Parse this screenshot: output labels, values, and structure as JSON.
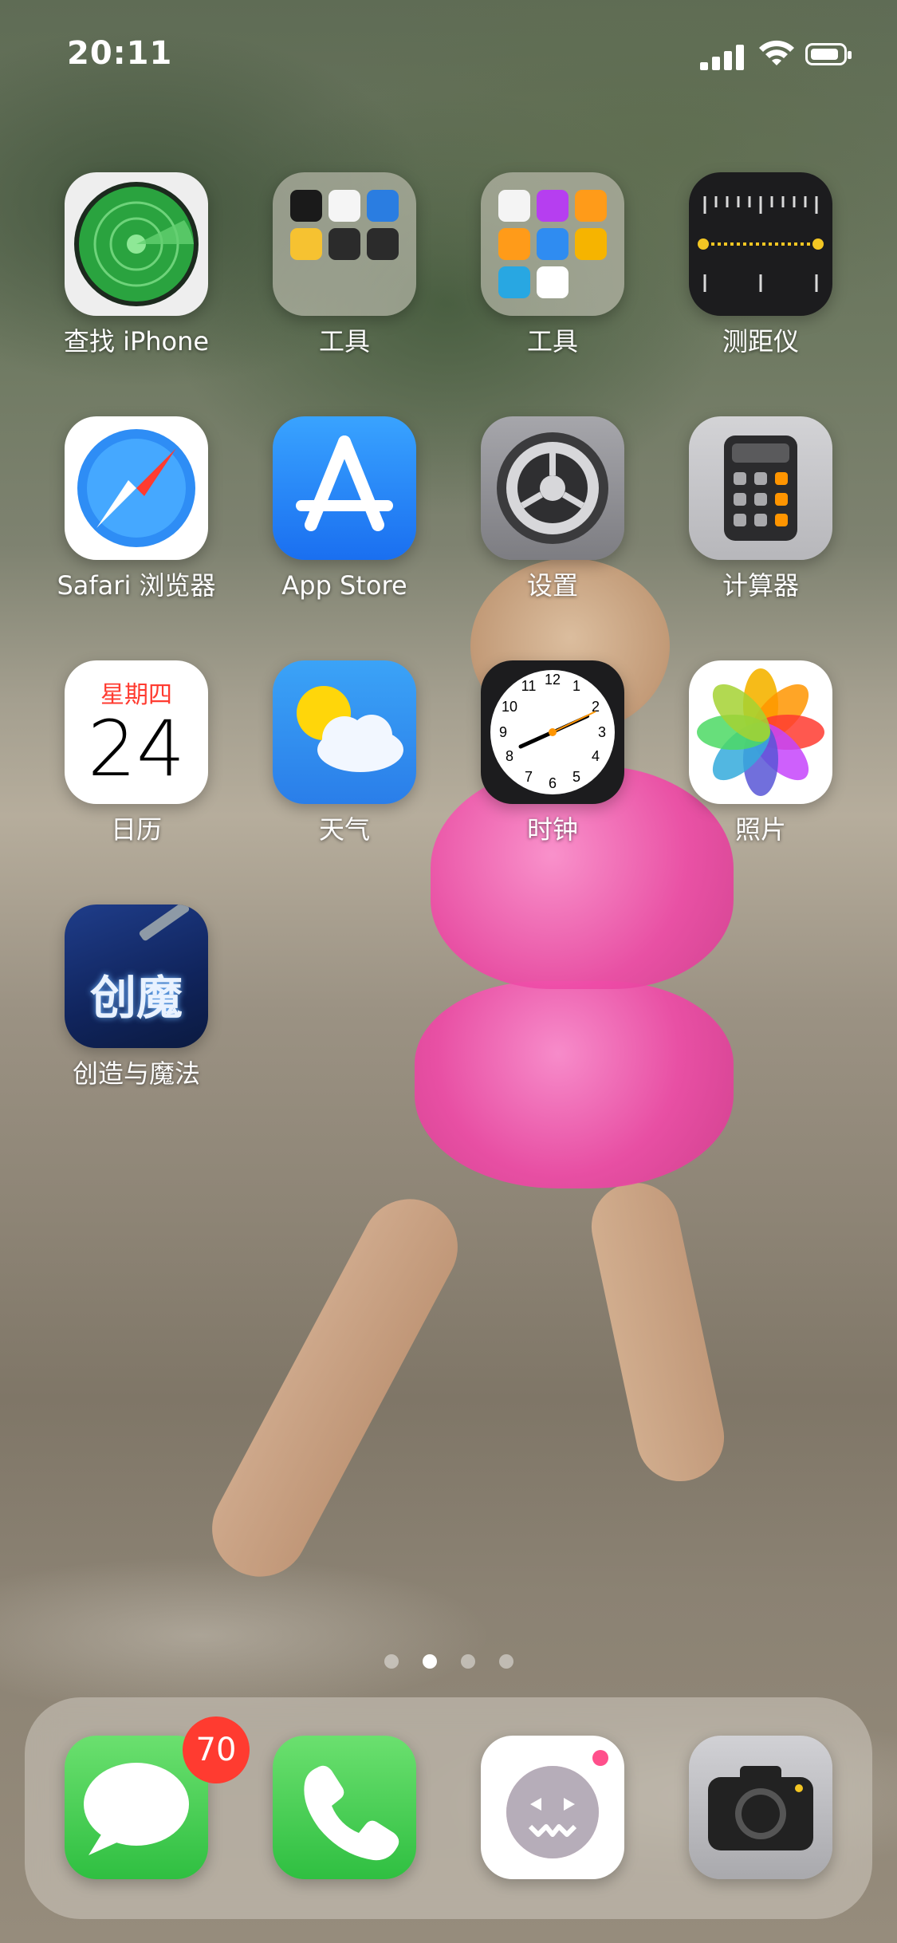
{
  "status_bar": {
    "time": "20:11"
  },
  "apps": [
    {
      "name": "查找 iPhone"
    },
    {
      "name": "工具"
    },
    {
      "name": "工具"
    },
    {
      "name": "测距仪"
    },
    {
      "name": "Safari 浏览器"
    },
    {
      "name": "App Store"
    },
    {
      "name": "设置"
    },
    {
      "name": "计算器"
    },
    {
      "name": "日历",
      "weekday": "星期四",
      "day": "24"
    },
    {
      "name": "天气"
    },
    {
      "name": "时钟",
      "clock_numbers": [
        "12",
        "1",
        "2",
        "3",
        "4",
        "5",
        "6",
        "7",
        "8",
        "9",
        "10",
        "11"
      ]
    },
    {
      "name": "照片"
    },
    {
      "name": "创造与魔法",
      "icon_text": "创魔"
    }
  ],
  "page_indicator": {
    "pages": 4,
    "current_page": 2
  },
  "dock": {
    "messages_badge": "70",
    "apps": [
      "messages",
      "phone",
      "social",
      "camera"
    ]
  },
  "colors": {
    "badge": "#ff3b30",
    "status_text": "#ffffff"
  }
}
